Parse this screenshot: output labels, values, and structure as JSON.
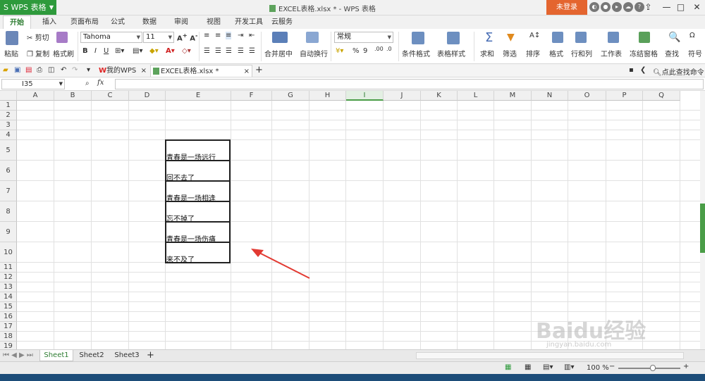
{
  "titlebar": {
    "app_name": "S WPS 表格",
    "doc_title": "EXCEL表格.xlsx * - WPS 表格",
    "login_label": "未登录",
    "help_label": "?",
    "min_label": "—",
    "max_label": "□",
    "close_label": "✕"
  },
  "tabs": [
    "开始",
    "插入",
    "页面布局",
    "公式",
    "数据",
    "审阅",
    "视图",
    "开发工具",
    "云服务"
  ],
  "ribbon": {
    "paste": "粘贴",
    "cut": "剪切",
    "copy": "复制",
    "format_painter": "格式刷",
    "font_name": "Tahoma",
    "font_size": "11",
    "merge_center": "合并居中",
    "wrap_text": "自动换行",
    "number_format": "常规",
    "percent": "%",
    "comma": "9",
    "conditional_format": "条件格式",
    "table_style": "表格样式",
    "sum": "求和",
    "filter": "筛选",
    "sort": "排序",
    "format": "格式",
    "row_col": "行和列",
    "worksheet": "工作表",
    "freeze": "冻结窗格",
    "find": "查找",
    "symbol": "符号"
  },
  "quickbar": {
    "tab_mywps": "我的WPS",
    "tab_excel": "EXCEL表格.xlsx *",
    "search_cmd": "点此查找命令"
  },
  "formula_bar": {
    "cell_ref": "I35",
    "fx_label": "fx",
    "value": ""
  },
  "columns": [
    "A",
    "B",
    "C",
    "D",
    "E",
    "F",
    "G",
    "H",
    "I",
    "J",
    "K",
    "L",
    "M",
    "N",
    "O",
    "P",
    "Q"
  ],
  "rows": [
    "1",
    "2",
    "3",
    "4",
    "5",
    "6",
    "7",
    "8",
    "9",
    "10",
    "11",
    "12",
    "13",
    "14",
    "15",
    "16",
    "17",
    "18",
    "19"
  ],
  "cells": {
    "E5": "青春是一场远行",
    "E6": "回不去了",
    "E7": "青春是一场相逢",
    "E8": "忘不掉了",
    "E9": "青春是一场伤痛",
    "E10": "来不及了"
  },
  "sheets": [
    "Sheet1",
    "Sheet2",
    "Sheet3"
  ],
  "status": {
    "zoom": "100 %"
  },
  "watermark": {
    "text": "Baidu经验",
    "sub": "jingyan.baidu.com"
  },
  "colors": {
    "accent_green": "#2e9a3c",
    "login_orange": "#e4652f",
    "arrow_red": "#e23a32"
  }
}
